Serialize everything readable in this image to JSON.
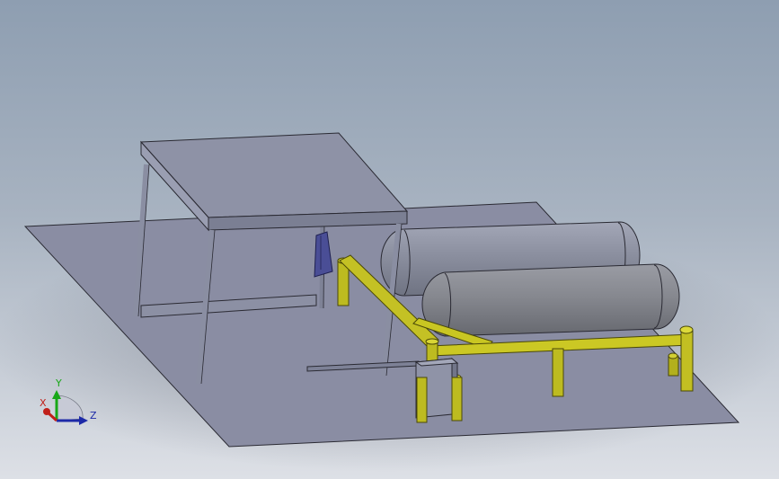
{
  "viewport": {
    "background_top": "#8e9eb1",
    "background_bottom": "#dde0e6"
  },
  "scene": {
    "floor_color": "#8a8da3",
    "table_color": "#8c90a4",
    "tank_color": "#8a8e9e",
    "front_tank_color": "#888a90",
    "pipe_color": "#c9c622",
    "bracket_color": "#4a4e96"
  },
  "triad": {
    "x_label": "X",
    "y_label": "Y",
    "z_label": "Z",
    "x_color": "#c0201a",
    "y_color": "#18a818",
    "z_color": "#1d2aa8"
  }
}
